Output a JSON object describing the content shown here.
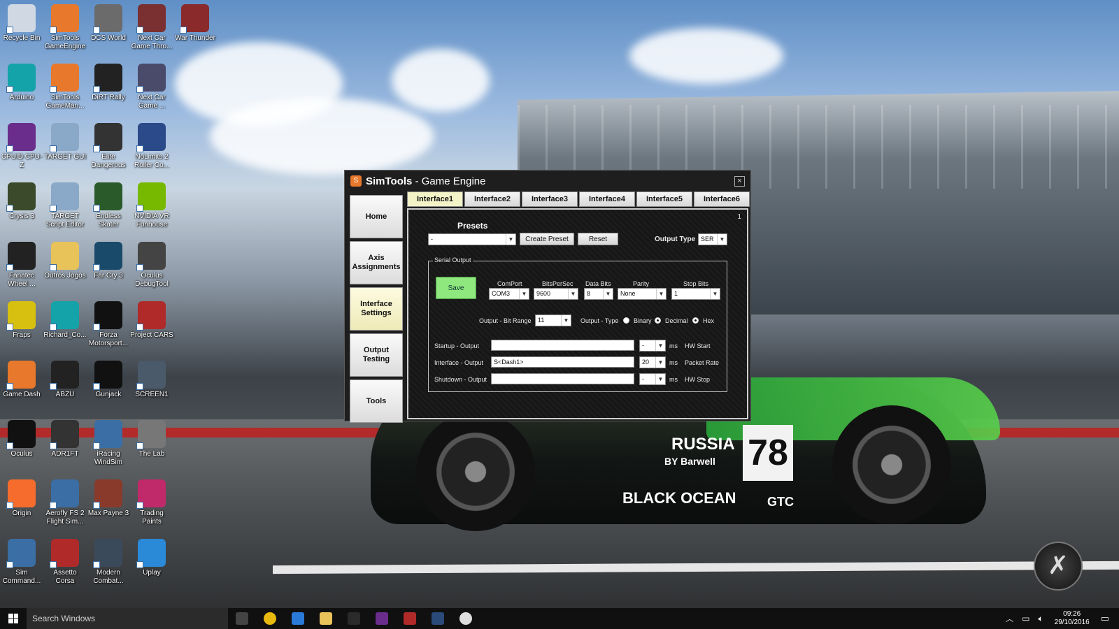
{
  "desktop": {
    "icons": [
      {
        "label": "Recycle Bin",
        "icon": "recycle-bin-icon",
        "color": "#cfd8e3"
      },
      {
        "label": "SimTools GameEngine",
        "icon": "simtools-icon",
        "color": "#e8782b"
      },
      {
        "label": "DCS World",
        "icon": "dcs-icon",
        "color": "#6b6b6b"
      },
      {
        "label": "Next Car Game Thro...",
        "icon": "nextcar-icon",
        "color": "#7a3030"
      },
      {
        "label": "War Thunder",
        "icon": "warthunder-icon",
        "color": "#8a2a2a"
      },
      {
        "label": "Arduino",
        "icon": "arduino-icon",
        "color": "#13a3a8"
      },
      {
        "label": "SimTools GameMan...",
        "icon": "simtools-icon",
        "color": "#e8782b"
      },
      {
        "label": "DiRT Rally",
        "icon": "dirt-icon",
        "color": "#222222"
      },
      {
        "label": "Next Car Game ...",
        "icon": "nextcar-icon",
        "color": "#4a4a6a"
      },
      {
        "label": "CPUID CPU-Z",
        "icon": "cpuz-icon",
        "color": "#6a2d8c"
      },
      {
        "label": "TARGET GUI",
        "icon": "target-icon",
        "color": "#8aa8c8"
      },
      {
        "label": "Elite Dangerous",
        "icon": "elite-icon",
        "color": "#333333"
      },
      {
        "label": "NoLimits 2 Roller Co...",
        "icon": "nolimits-icon",
        "color": "#2a4a8a"
      },
      {
        "label": "Crysis 3",
        "icon": "crysis-icon",
        "color": "#3a4a2a"
      },
      {
        "label": "TARGET Script Editor",
        "icon": "target-icon",
        "color": "#8aa8c8"
      },
      {
        "label": "Endless Skater",
        "icon": "skater-icon",
        "color": "#2a5a2a"
      },
      {
        "label": "NVIDIA VR Funhouse",
        "icon": "nvidia-icon",
        "color": "#76b900"
      },
      {
        "label": "Fanatec Wheel ...",
        "icon": "fanatec-icon",
        "color": "#222222"
      },
      {
        "label": "Outros Jogos",
        "icon": "folder-icon",
        "color": "#e8c35a"
      },
      {
        "label": "Far Cry 3",
        "icon": "farcry-icon",
        "color": "#1a4a6a"
      },
      {
        "label": "Oculus DebugTool",
        "icon": "oculus-icon",
        "color": "#444444"
      },
      {
        "label": "Fraps",
        "icon": "fraps-icon",
        "color": "#d8c010"
      },
      {
        "label": "Richard_Co...",
        "icon": "arduino-icon",
        "color": "#13a3a8"
      },
      {
        "label": "Forza Motorsport...",
        "icon": "forza-icon",
        "color": "#111111"
      },
      {
        "label": "Project CARS",
        "icon": "pcars-icon",
        "color": "#b02a2a"
      },
      {
        "label": "Game Dash",
        "icon": "gamedash-icon",
        "color": "#e8782b"
      },
      {
        "label": "ABZU",
        "icon": "abzu-icon",
        "color": "#222222"
      },
      {
        "label": "Gunjack",
        "icon": "gunjack-icon",
        "color": "#111111"
      },
      {
        "label": "SCREEN1",
        "icon": "screen-icon",
        "color": "#4a5a6a"
      },
      {
        "label": "Oculus",
        "icon": "oculus-icon",
        "color": "#111111"
      },
      {
        "label": "ADR1FT",
        "icon": "adrift-icon",
        "color": "#333333"
      },
      {
        "label": "iRacing WindSim",
        "icon": "iracing-icon",
        "color": "#3a6ea5"
      },
      {
        "label": "The Lab",
        "icon": "thelab-icon",
        "color": "#777777"
      },
      {
        "label": "Origin",
        "icon": "origin-icon",
        "color": "#f56c2d"
      },
      {
        "label": "Aerofly FS 2 Flight Sim...",
        "icon": "aerofly-icon",
        "color": "#3a6ea5"
      },
      {
        "label": "Max Payne 3",
        "icon": "maxpayne-icon",
        "color": "#8a3a2a"
      },
      {
        "label": "Trading Paints",
        "icon": "tradingpaints-icon",
        "color": "#c02a6a"
      },
      {
        "label": "Sim Command...",
        "icon": "simcommander-icon",
        "color": "#3a6ea5"
      },
      {
        "label": "Assetto Corsa",
        "icon": "assetto-icon",
        "color": "#b02a2a"
      },
      {
        "label": "Modern Combat...",
        "icon": "moderncombat-icon",
        "color": "#3a4a5a"
      },
      {
        "label": "Uplay",
        "icon": "uplay-icon",
        "color": "#2a8ad8"
      }
    ],
    "car": {
      "number": "78",
      "sponsor": "BLACK OCEAN",
      "badge": "GTC",
      "text": "RUSSIA",
      "sub": "BY Barwell"
    }
  },
  "window": {
    "title_bold": "SimTools",
    "title_rest": " - Game Engine",
    "close": "×",
    "sidebar": [
      {
        "label": "Home",
        "active": false
      },
      {
        "label": "Axis Assignments",
        "active": false
      },
      {
        "label": "Interface Settings",
        "active": true
      },
      {
        "label": "Output Testing",
        "active": false
      },
      {
        "label": "Tools",
        "active": false
      }
    ],
    "tabs": [
      "Interface1",
      "Interface2",
      "Interface3",
      "Interface4",
      "Interface5",
      "Interface6"
    ],
    "active_tab": 0,
    "panel": {
      "number": "1",
      "presets_title": "Presets",
      "preset_value": "-",
      "create_preset": "Create Preset",
      "reset": "Reset",
      "output_type_label": "Output Type",
      "output_type_value": "SER",
      "serial_output_legend": "Serial Output",
      "save": "Save",
      "comport": {
        "label": "ComPort",
        "value": "COM3"
      },
      "bitspersec": {
        "label": "BitsPerSec",
        "value": "9600"
      },
      "databits": {
        "label": "Data Bits",
        "value": "8"
      },
      "parity": {
        "label": "Parity",
        "value": "None"
      },
      "stopbits": {
        "label": "Stop Bits",
        "value": "1"
      },
      "bitrange": {
        "label": "Output - Bit Range",
        "value": "11"
      },
      "output_type2_label": "Output - Type",
      "radios": [
        {
          "label": "Binary",
          "checked": false
        },
        {
          "label": "Decimal",
          "checked": true
        },
        {
          "label": "Hex",
          "checked": true
        }
      ],
      "rows": [
        {
          "label": "Startup - Output",
          "value": "",
          "ms_value": "-",
          "unit": "ms",
          "right": "HW Start"
        },
        {
          "label": "Interface - Output",
          "value": "S<Dash1>",
          "ms_value": "20",
          "unit": "ms",
          "right": "Packet Rate"
        },
        {
          "label": "Shutdown - Output",
          "value": "",
          "ms_value": "-",
          "unit": "ms",
          "right": "HW Stop"
        }
      ]
    }
  },
  "taskbar": {
    "search_placeholder": "Search Windows",
    "time": "09:26",
    "date": "29/10/2016",
    "pinned": [
      {
        "icon": "task-view-icon",
        "color": "#444444"
      },
      {
        "icon": "chrome-icon",
        "color": "#e8b90e"
      },
      {
        "icon": "edge-icon",
        "color": "#2a7ad8"
      },
      {
        "icon": "file-explorer-icon",
        "color": "#e8c35a"
      },
      {
        "icon": "store-icon",
        "color": "#2a2a2a"
      },
      {
        "icon": "cpuz-icon",
        "color": "#6a2d8c"
      },
      {
        "icon": "simtools-icon",
        "color": "#b02a2a"
      },
      {
        "icon": "steam-icon",
        "color": "#2a4a7a"
      },
      {
        "icon": "xbox-icon",
        "color": "#dddddd"
      }
    ]
  }
}
